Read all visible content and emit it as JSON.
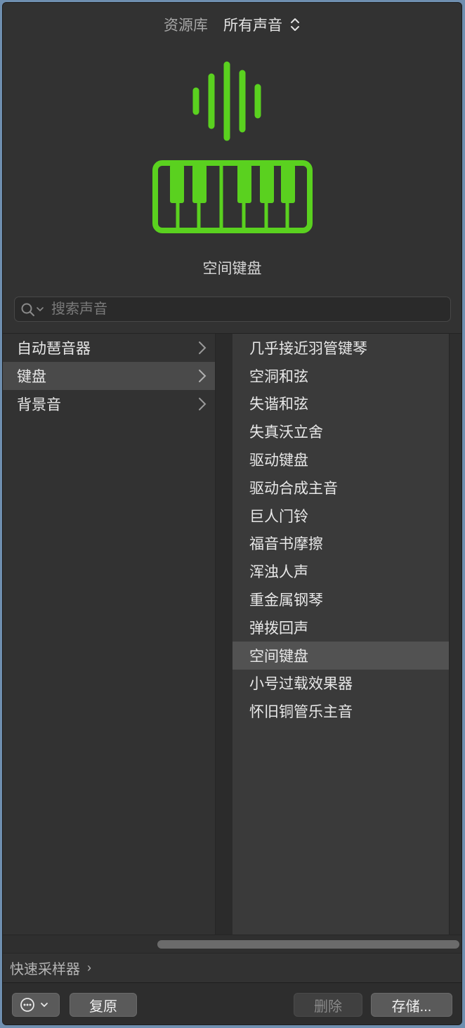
{
  "header": {
    "library_label": "资源库",
    "library_value": "所有声音"
  },
  "patch_title": "空间键盘",
  "colors": {
    "accent": "#5ad11f"
  },
  "search": {
    "placeholder": "搜索声音"
  },
  "categories": [
    {
      "label": "自动琶音器",
      "selected": false
    },
    {
      "label": "键盘",
      "selected": true
    },
    {
      "label": "背景音",
      "selected": false
    }
  ],
  "patches": [
    "几乎接近羽管键琴",
    "空洞和弦",
    "失谐和弦",
    "失真沃立舍",
    "驱动键盘",
    "驱动合成主音",
    "巨人门铃",
    "福音书摩擦",
    "浑浊人声",
    "重金属钢琴",
    "弹拨回声",
    "空间键盘",
    "小号过载效果器",
    "怀旧铜管乐主音"
  ],
  "selected_patch": "空间键盘",
  "quick_sampler": {
    "label": "快速采样器",
    "arrow": "›"
  },
  "footer": {
    "revert_label": "复原",
    "delete_label": "删除",
    "save_label": "存储..."
  }
}
